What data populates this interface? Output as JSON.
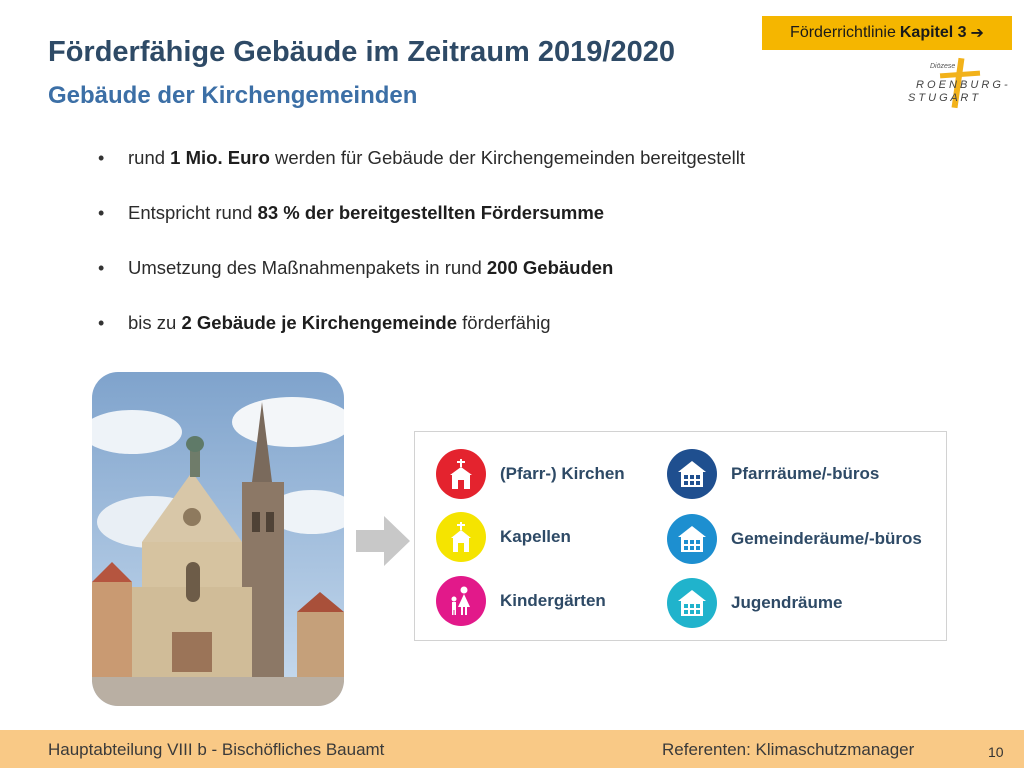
{
  "header": {
    "chapter_link_prefix": "Förderrichtlinie",
    "chapter_link_bold": "Kapitel 3",
    "chapter_link_arrow": "➔",
    "title": "Förderfähige Gebäude im Zeitraum 2019/2020",
    "subtitle": "Gebäude der Kirchengemeinden"
  },
  "logo": {
    "small_text": "Diözese",
    "line1": "R O     E N B U R G -",
    "line2": "S T U     G A R T",
    "cross_color": "#f2b21a"
  },
  "bullets": [
    {
      "pre": "rund ",
      "bold": "1 Mio. Euro",
      "post": " werden für Gebäude der Kirchengemeinden bereitgestellt"
    },
    {
      "pre": "Entspricht rund ",
      "bold": "83 % der bereitgestellten Fördersumme",
      "post": ""
    },
    {
      "pre": "Umsetzung des Maßnahmenpakets in rund ",
      "bold": "200 Gebäuden",
      "post": ""
    },
    {
      "pre": "bis zu ",
      "bold": "2 Gebäude je Kirchengemeinde",
      "post": " förderfähig"
    }
  ],
  "categories": {
    "kirchen": {
      "label": "(Pfarr-) Kirchen",
      "color": "#e4232e",
      "icon": "church-icon"
    },
    "kapellen": {
      "label": "Kapellen",
      "color": "#f5e400",
      "icon": "chapel-icon"
    },
    "kindergaerten": {
      "label": "Kindergärten",
      "color": "#e2198a",
      "icon": "family-icon"
    },
    "pfarrraeume": {
      "label": "Pfarrräume/-büros",
      "color": "#1f4f8f",
      "icon": "house-icon"
    },
    "gemeinderaeume": {
      "label": "Gemeinderäume/-büros",
      "color": "#1d8fd0",
      "icon": "house-icon"
    },
    "jugendraeume": {
      "label": "Jugendräume",
      "color": "#20b3cc",
      "icon": "house-icon"
    }
  },
  "footer": {
    "left": "Hauptabteilung VIII b - Bischöfliches Bauamt",
    "right": "Referenten: Klimaschutzmanager",
    "page_number": "10",
    "color": "#f9c986"
  }
}
